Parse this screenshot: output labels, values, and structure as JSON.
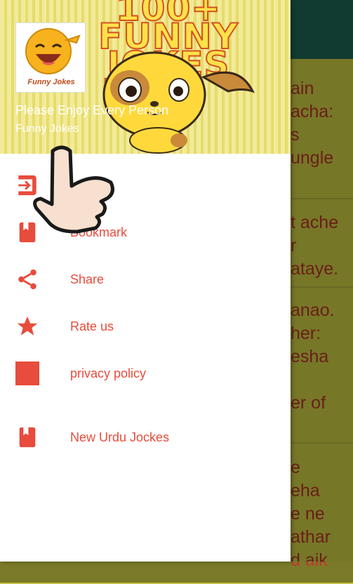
{
  "header": {
    "banner_line1": "100+",
    "banner_line2": "FUNNY",
    "banner_line3": "JOKES",
    "logo_caption": "Funny Jokes",
    "title": "Please Enjoy Every Person",
    "subtitle": "Funny Jokes"
  },
  "menu": {
    "items": [
      {
        "label": "",
        "icon": "exit-icon"
      },
      {
        "label": "Bookmark",
        "icon": "bookmark-icon"
      },
      {
        "label": "Share",
        "icon": "share-icon"
      },
      {
        "label": "Rate us",
        "icon": "star-icon"
      },
      {
        "label": "privacy policy",
        "icon": "square-icon"
      },
      {
        "label": "New Urdu Jockes",
        "icon": "bookmark-icon"
      }
    ]
  },
  "background_jokes": [
    [
      "ain",
      "acha:",
      "s",
      "ungle"
    ],
    [
      "t ache",
      "r",
      "ataye."
    ],
    [
      "anao.",
      "her:",
      "esha",
      "",
      "er of"
    ],
    [
      "e",
      "eha",
      "e ne",
      "athar",
      "d aik"
    ]
  ],
  "colors": {
    "accent": "#e74c3c",
    "appbar": "#1f6a58",
    "content_bg": "#d9d94a"
  }
}
